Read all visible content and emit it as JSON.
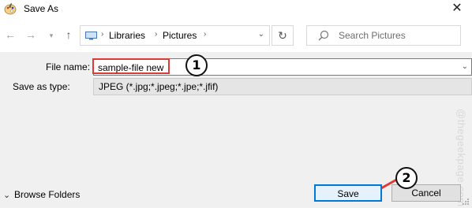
{
  "window": {
    "title": "Save As"
  },
  "address_bar": {
    "crumbs": [
      "Libraries",
      "Pictures"
    ]
  },
  "search": {
    "placeholder": "Search Pictures"
  },
  "form": {
    "file_name_label": "File name:",
    "file_name_value": "sample-file new",
    "save_as_type_label": "Save as type:",
    "save_as_type_value": "JPEG (*.jpg;*.jpeg;*.jpe;*.jfif)"
  },
  "footer": {
    "browse_folders": "Browse Folders",
    "save_label": "Save",
    "cancel_label": "Cancel"
  },
  "annotations": {
    "badge_1": "1",
    "badge_2": "2"
  },
  "watermark": "@thegeekpage.com",
  "colors": {
    "highlight_red": "#e03a36",
    "focus_blue": "#0078d7"
  }
}
